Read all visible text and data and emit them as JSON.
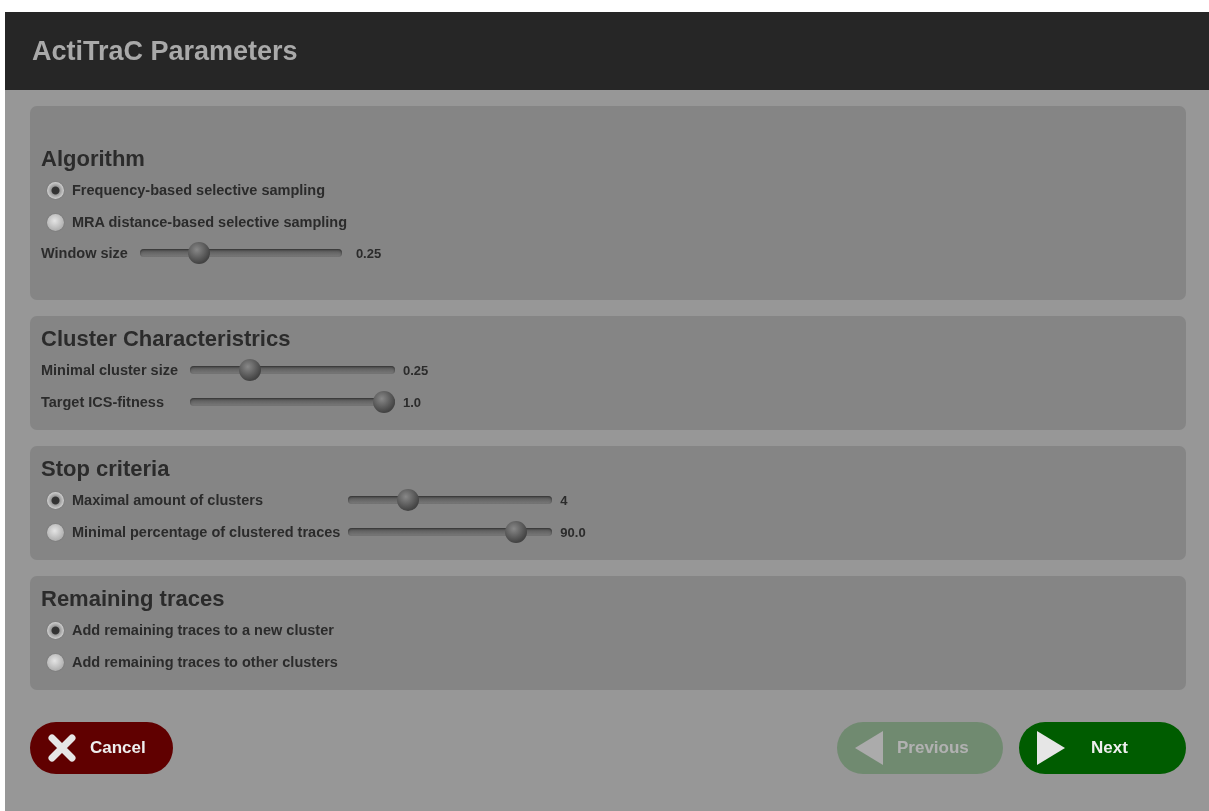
{
  "window": {
    "title": "ActiTraC Parameters"
  },
  "sections": [
    {
      "title": "Algorithm",
      "rows": [
        {
          "kind": "radio",
          "label": "Frequency-based selective sampling",
          "selected": true
        },
        {
          "kind": "radio",
          "label": "MRA distance-based selective sampling",
          "selected": false
        },
        {
          "kind": "slider",
          "label": "Window size",
          "level": 0.27,
          "reading": "0.25"
        }
      ]
    },
    {
      "title": "Cluster Characteristrics",
      "rows": [
        {
          "kind": "slider",
          "label": "Minimal cluster size",
          "level": 0.27,
          "reading": "0.25"
        },
        {
          "kind": "slider",
          "label": "Target ICS-fitness",
          "level": 1.0,
          "reading": "1.0"
        }
      ]
    },
    {
      "title": "Stop criteria",
      "rows": [
        {
          "kind": "radio-slider",
          "label": "Maximal amount of clusters",
          "selected": true,
          "level": 0.27,
          "reading": "4"
        },
        {
          "kind": "radio-slider",
          "label": "Minimal percentage of clustered traces",
          "selected": false,
          "level": 0.86,
          "reading": "90.0"
        }
      ]
    },
    {
      "title": "Remaining traces",
      "rows": [
        {
          "kind": "radio",
          "label": "Add remaining traces to a new cluster",
          "selected": true
        },
        {
          "kind": "radio",
          "label": "Add remaining traces to other clusters",
          "selected": false
        }
      ]
    }
  ],
  "buttons": [
    {
      "kind": "cancel",
      "label": "Cancel",
      "disabled": false
    },
    {
      "kind": "previous",
      "label": "Previous",
      "disabled": true
    },
    {
      "kind": "next",
      "label": "Next",
      "disabled": false
    }
  ]
}
